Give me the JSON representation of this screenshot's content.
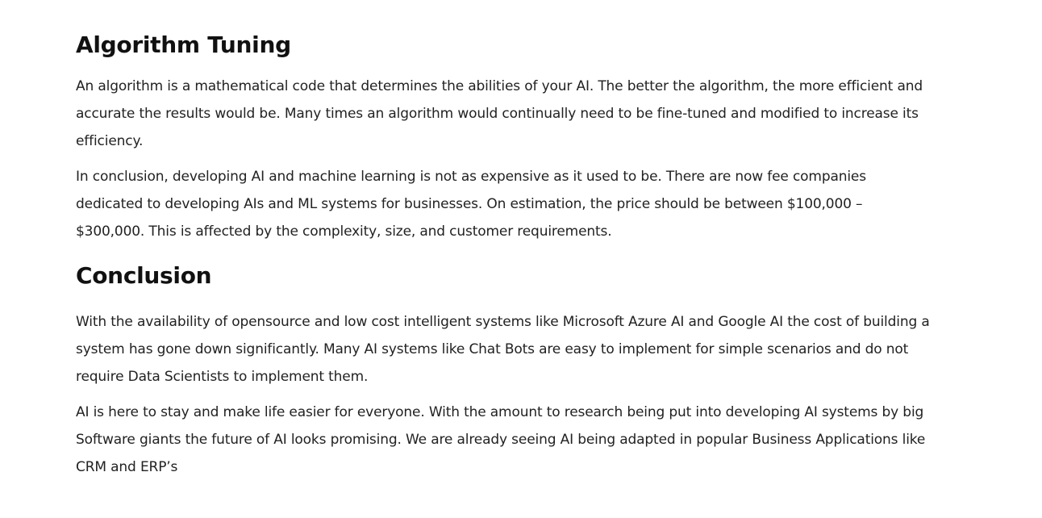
{
  "sections": [
    {
      "heading": "Algorithm Tuning",
      "paragraphs": [
        "An algorithm is a mathematical code that determines the abilities of your AI. The better the algorithm, the more efficient and accurate the results would be. Many times an algorithm would continually need to be fine-tuned and modified to increase its efficiency.",
        "In conclusion, developing AI and machine learning is not as expensive as it used to be. There are now fee companies dedicated to developing AIs and ML systems for businesses. On estimation, the price should be between $100,000 – $300,000. This is affected by the complexity, size, and customer requirements."
      ]
    },
    {
      "heading": "Conclusion",
      "paragraphs": [
        "With the availability of opensource and low cost intelligent systems like Microsoft Azure AI and Google AI the cost of building a system has gone down significantly. Many AI systems like Chat Bots are easy to implement for simple scenarios and do not require Data Scientists to implement them.",
        "AI is here to stay and make life easier for everyone. With the amount to research being put into developing AI systems by big Software giants the future of AI looks promising. We are already seeing AI being adapted in popular Business Applications like CRM and ERP’s"
      ]
    }
  ]
}
